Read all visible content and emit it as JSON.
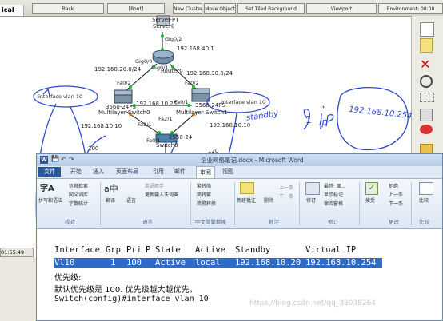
{
  "pt": {
    "tab_label": "ical",
    "toolbar": [
      "Back",
      "[Root]",
      "New Cluster",
      "Move Object",
      "Set Tiled Background",
      "Viewport",
      "Environment: 00:00"
    ],
    "clock": "01:55:49",
    "counter": "100"
  },
  "topology": {
    "server": {
      "label_top": "Server-PT",
      "label": "Server0"
    },
    "router": {
      "label": "Router0"
    },
    "left_switch": {
      "model": "3560-24PS",
      "label": "Multilayer Switch0"
    },
    "right_switch": {
      "model": "3560-24PS",
      "label": "Multilayer Switch1"
    },
    "bottom_switch": {
      "model": "2950-24",
      "label": "Switch0"
    },
    "ports": {
      "srv_gi": "Gig0/2",
      "r_gi0": "Gig0/0",
      "r_gi1": "Gig0/1",
      "ls_fa2": "Fa0/2",
      "ls_fa1": "Fa0/1",
      "rs_fa2": "Fa0/2",
      "rs_fa1": "Fa0/1",
      "sw_fa1": "Fa1/1",
      "sw_fa2": "Fa2/1",
      "sw_fa3": "Fa0/1"
    },
    "networks": {
      "n40": "192.168.40.1",
      "n20": "192.168.20.0/24",
      "n30": "192.168.30.0/24",
      "ip25": "192.168.10.25",
      "ip26": "192.168.10.26",
      "ip10_left": "192.168.10.10",
      "ip10_right": "192.168.10.10",
      "num120": "120"
    }
  },
  "annotations": {
    "left_box": "interface vlan 10",
    "right_box": "interface vlan 10",
    "standby": "standby",
    "one": "1",
    "ip": "ip",
    "vip": "192.168.10.254"
  },
  "word": {
    "title": "企业网络笔记.docx - Microsoft Word",
    "tabs": {
      "file": "文件",
      "home": "开始",
      "insert": "插入",
      "layout": "页面布局",
      "refs": "引用",
      "mail": "邮件",
      "review": "审阅",
      "view": "视图"
    },
    "ribbon": {
      "spell": "拼写和语法",
      "info": "信息检索",
      "thesaurus": "同义词库",
      "wordcount": "字数统计",
      "group_proof": "校对",
      "translate": "翻译",
      "lang": "语言",
      "en_helper": "英语助手",
      "update_ime": "更新输入法词典",
      "group_lang": "语言",
      "trad": "繁转简",
      "simp": "简转繁",
      "conv": "简繁转换",
      "group_conv": "中文简繁转换",
      "new_comment": "新建批注",
      "delete": "删除",
      "prev": "上一条",
      "next": "下一条",
      "group_comment": "批注",
      "track": "修订",
      "markup": "最终: 显…",
      "show_markup": "显示标记",
      "review_pane": "审阅窗格",
      "group_track": "修订",
      "accept": "接受",
      "reject": "拒绝",
      "prev_change": "上一条",
      "next_change": "下一条",
      "group_changes": "更改",
      "compare": "比较",
      "group_compare": "比较"
    },
    "doc": {
      "header": {
        "iface": "Interface",
        "grp": "Grp",
        "pri": "Pri",
        "p": "P",
        "state": "State",
        "active": "Active",
        "standby": "Standby",
        "vip": "Virtual IP"
      },
      "row": {
        "iface": "Vl10",
        "grp": "1",
        "pri": "100",
        "state": "Active",
        "active": "local",
        "standby": "192.168.10.20",
        "vip": "192.168.10.254"
      },
      "line1": "优先级:",
      "line2": "默认优先级是 100. 优先级越大越优先。",
      "line3": "Switch(config)#interface vlan 10",
      "watermark": "https://blog.csdn.net/qq_38038264"
    }
  }
}
